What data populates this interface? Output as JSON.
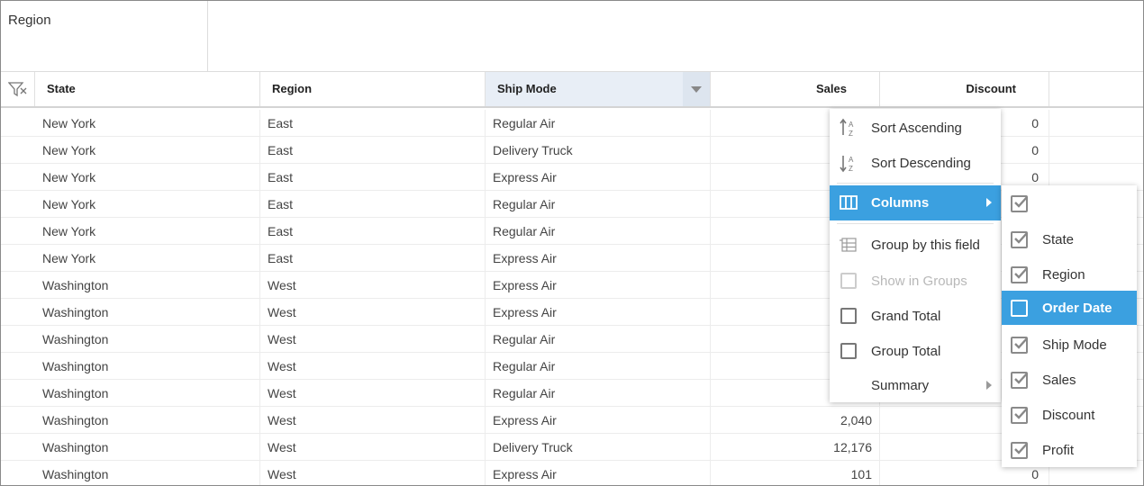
{
  "group_panel": {
    "chip_label": "Region"
  },
  "columns": {
    "state": "State",
    "region": "Region",
    "ship_mode": "Ship Mode",
    "sales": "Sales",
    "discount": "Discount"
  },
  "rows": [
    {
      "state": "New York",
      "region": "East",
      "ship_mode": "Regular Air",
      "sales": "",
      "discount": "0"
    },
    {
      "state": "New York",
      "region": "East",
      "ship_mode": "Delivery Truck",
      "sales": "",
      "discount": "0"
    },
    {
      "state": "New York",
      "region": "East",
      "ship_mode": "Express Air",
      "sales": "",
      "discount": "0"
    },
    {
      "state": "New York",
      "region": "East",
      "ship_mode": "Regular Air",
      "sales": "",
      "discount": ""
    },
    {
      "state": "New York",
      "region": "East",
      "ship_mode": "Regular Air",
      "sales": "",
      "discount": ""
    },
    {
      "state": "New York",
      "region": "East",
      "ship_mode": "Express Air",
      "sales": "",
      "discount": ""
    },
    {
      "state": "Washington",
      "region": "West",
      "ship_mode": "Express Air",
      "sales": "",
      "discount": ""
    },
    {
      "state": "Washington",
      "region": "West",
      "ship_mode": "Express Air",
      "sales": "",
      "discount": ""
    },
    {
      "state": "Washington",
      "region": "West",
      "ship_mode": "Regular Air",
      "sales": "",
      "discount": ""
    },
    {
      "state": "Washington",
      "region": "West",
      "ship_mode": "Regular Air",
      "sales": "",
      "discount": ""
    },
    {
      "state": "Washington",
      "region": "West",
      "ship_mode": "Regular Air",
      "sales": "",
      "discount": ""
    },
    {
      "state": "Washington",
      "region": "West",
      "ship_mode": "Express Air",
      "sales": "2,040",
      "discount": ""
    },
    {
      "state": "Washington",
      "region": "West",
      "ship_mode": "Delivery Truck",
      "sales": "12,176",
      "discount": ""
    },
    {
      "state": "Washington",
      "region": "West",
      "ship_mode": "Express Air",
      "sales": "101",
      "discount": "0"
    }
  ],
  "context_menu": {
    "sort_ascending": "Sort Ascending",
    "sort_descending": "Sort Descending",
    "columns": "Columns",
    "group_by": "Group by this field",
    "show_in_groups": "Show in Groups",
    "grand_total": "Grand Total",
    "group_total": "Group Total",
    "summary": "Summary"
  },
  "columns_submenu": [
    {
      "label": "",
      "checked": true
    },
    {
      "label": "State",
      "checked": true
    },
    {
      "label": "Region",
      "checked": true
    },
    {
      "label": "Order Date",
      "checked": false,
      "highlighted": true
    },
    {
      "label": "Ship Mode",
      "checked": true
    },
    {
      "label": "Sales",
      "checked": true
    },
    {
      "label": "Discount",
      "checked": true
    },
    {
      "label": "Profit",
      "checked": true
    }
  ],
  "colors": {
    "accent": "#3ba0e0",
    "header_highlight": "#e8eef6"
  },
  "icons": {
    "filter": "filter-icon",
    "sort_asc": "sort-ascending-icon",
    "sort_desc": "sort-descending-icon",
    "columns": "columns-icon",
    "group": "group-icon"
  }
}
